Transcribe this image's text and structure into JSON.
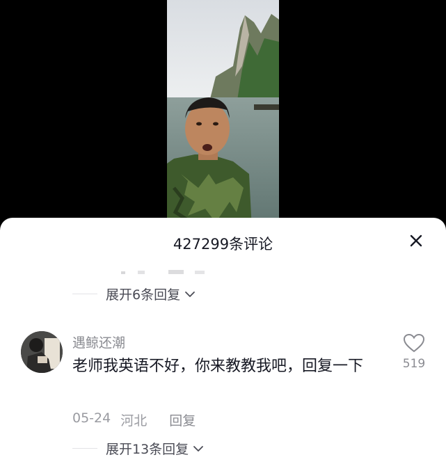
{
  "video": {
    "description_icon": "video-frame"
  },
  "sheet": {
    "title": "427299条评论",
    "close_icon": "close-icon"
  },
  "thread1": {
    "expand_label": "展开6条回复"
  },
  "comment": {
    "username": "遇鲸还潮",
    "text": "老师我英语不好，你来教教我吧，回复一下",
    "date": "05-24",
    "location": "河北",
    "reply_label": "回复",
    "likes": "519",
    "expand_label": "展开13条回复"
  },
  "colors": {
    "primary_text": "#161823",
    "secondary_text": "#8a8b91",
    "sheet_bg": "#ffffff"
  }
}
